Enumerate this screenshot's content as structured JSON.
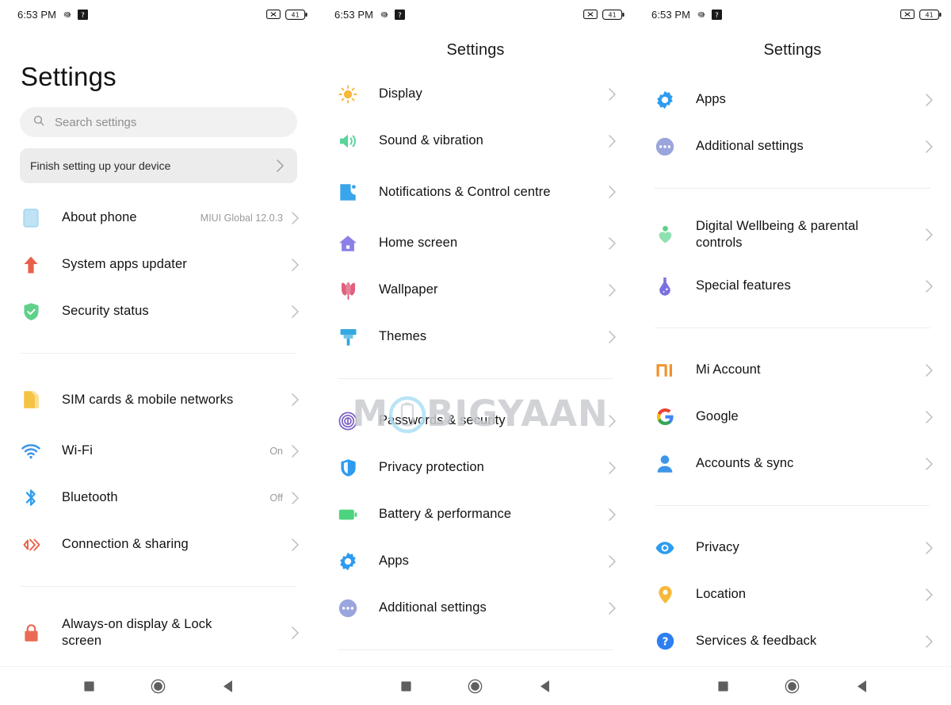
{
  "statusbar": {
    "time": "6:53 PM",
    "icons_left": [
      "gear-icon",
      "question-badge-icon"
    ],
    "icons_right": [
      "no-sim-icon",
      "battery-icon"
    ],
    "battery_level": "41"
  },
  "watermark": {
    "text_before": "M",
    "logo": "phone-circle-logo",
    "text_after": "BIGYAAN"
  },
  "navbar": {
    "recents": "recents-square",
    "home": "home-circle",
    "back": "back-triangle"
  },
  "colors": {
    "about_phone": "#a8d8f0",
    "system_update": "#e8604c",
    "security": "#5fd18a",
    "sim": "#f5c344",
    "wifi": "#3d96e8",
    "bluetooth": "#2e9ef0",
    "connection": "#e8604c",
    "lock": "#ea6a55",
    "display": "#f6b93b",
    "sound": "#57d49a",
    "notifications": "#39a5ea",
    "home_screen": "#8b7fe8",
    "wallpaper": "#e0607e",
    "themes": "#35a8e0",
    "passwords": "#7b5fc4",
    "privacy_protection": "#2d9bf0",
    "battery": "#4ed37e",
    "apps": "#2d9bf0",
    "additional": "#9aa5dd",
    "wellbeing": "#5fd18a",
    "special": "#7a6fe0",
    "mi": "#f0912a",
    "accounts": "#3d96e8",
    "privacy_eye": "#2d9bf0",
    "location": "#f6b93b",
    "services": "#2d7ff0",
    "chevron": "#bdbdbd",
    "watermark": "#c9ccd1"
  },
  "panel1": {
    "title": "Settings",
    "search": {
      "placeholder": "Search settings",
      "icon": "search-icon"
    },
    "promo": {
      "label": "Finish setting up your device",
      "chevron": "chevron-right-icon"
    },
    "groups": [
      {
        "items": [
          {
            "label": "About phone",
            "value": "MIUI Global 12.0.3",
            "icon": "phone-outline-icon"
          },
          {
            "label": "System apps updater",
            "value": "",
            "icon": "up-arrow-icon"
          },
          {
            "label": "Security status",
            "value": "",
            "icon": "shield-check-icon"
          }
        ]
      },
      {
        "items": [
          {
            "label": "SIM cards & mobile networks",
            "value": "",
            "icon": "sim-card-icon"
          },
          {
            "label": "Wi-Fi",
            "value": "On",
            "icon": "wifi-icon"
          },
          {
            "label": "Bluetooth",
            "value": "Off",
            "icon": "bluetooth-icon"
          },
          {
            "label": "Connection & sharing",
            "value": "",
            "icon": "connection-sharing-icon"
          }
        ]
      },
      {
        "items": [
          {
            "label": "Always-on display & Lock screen",
            "value": "",
            "icon": "lock-icon"
          }
        ]
      }
    ]
  },
  "panel2": {
    "title": "Settings",
    "groups": [
      {
        "items": [
          {
            "label": "Display",
            "value": "",
            "icon": "brightness-sun-icon"
          },
          {
            "label": "Sound & vibration",
            "value": "",
            "icon": "speaker-icon"
          },
          {
            "label": "Notifications & Control centre",
            "value": "",
            "icon": "notification-icon"
          },
          {
            "label": "Home screen",
            "value": "",
            "icon": "home-icon"
          },
          {
            "label": "Wallpaper",
            "value": "",
            "icon": "tulip-icon"
          },
          {
            "label": "Themes",
            "value": "",
            "icon": "paint-brush-icon"
          }
        ]
      },
      {
        "items": [
          {
            "label": "Passwords & security",
            "value": "",
            "icon": "fingerprint-icon"
          },
          {
            "label": "Privacy protection",
            "value": "",
            "icon": "privacy-shield-icon"
          },
          {
            "label": "Battery & performance",
            "value": "",
            "icon": "battery-icon"
          },
          {
            "label": "Apps",
            "value": "",
            "icon": "gear-flower-icon"
          },
          {
            "label": "Additional settings",
            "value": "",
            "icon": "ellipsis-circle-icon"
          }
        ]
      }
    ]
  },
  "panel3": {
    "title": "Settings",
    "groups": [
      {
        "items": [
          {
            "label": "Apps",
            "value": "",
            "icon": "gear-flower-icon"
          },
          {
            "label": "Additional settings",
            "value": "",
            "icon": "ellipsis-circle-icon"
          }
        ]
      },
      {
        "items": [
          {
            "label": "Digital Wellbeing & parental controls",
            "value": "",
            "icon": "wellbeing-heart-icon"
          },
          {
            "label": "Special features",
            "value": "",
            "icon": "flask-icon"
          }
        ]
      },
      {
        "items": [
          {
            "label": "Mi Account",
            "value": "",
            "icon": "mi-logo-icon"
          },
          {
            "label": "Google",
            "value": "",
            "icon": "google-g-icon"
          },
          {
            "label": "Accounts & sync",
            "value": "",
            "icon": "person-icon"
          }
        ]
      },
      {
        "items": [
          {
            "label": "Privacy",
            "value": "",
            "icon": "eye-icon"
          },
          {
            "label": "Location",
            "value": "",
            "icon": "location-pin-icon"
          },
          {
            "label": "Services & feedback",
            "value": "",
            "icon": "question-circle-icon"
          }
        ]
      }
    ]
  }
}
